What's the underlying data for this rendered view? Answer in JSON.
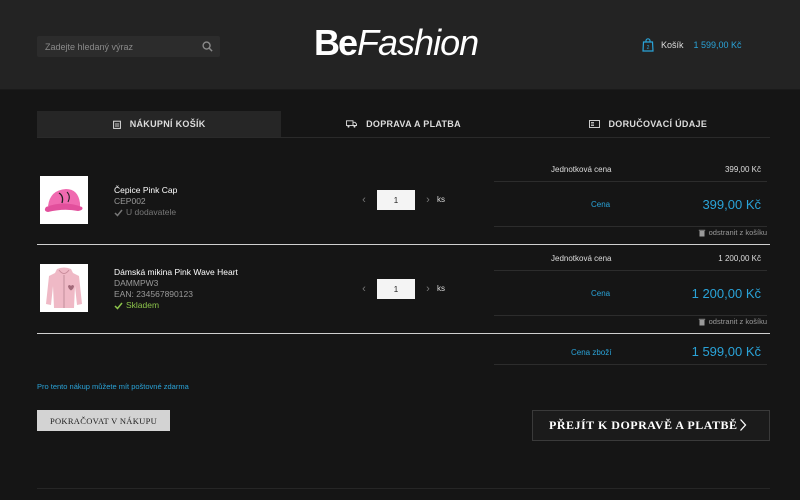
{
  "header": {
    "search_placeholder": "Zadejte hledaný výraz",
    "logo_be": "Be",
    "logo_fashion": "Fashion",
    "cart_label": "Košík",
    "cart_total": "1 599,00 Kč"
  },
  "steps": [
    {
      "label": "NÁKUPNÍ KOŠÍK",
      "icon": "cart-list-icon",
      "active": true
    },
    {
      "label": "DOPRAVA A PLATBA",
      "icon": "truck-icon",
      "active": false
    },
    {
      "label": "DORUČOVACÍ ÚDAJE",
      "icon": "address-card-icon",
      "active": false
    }
  ],
  "items": [
    {
      "name": "Čepice Pink Cap",
      "code": "CEP002",
      "ean": "",
      "availability": "U dodavatele",
      "qty": "1",
      "qty_unit": "ks",
      "unit_price_label": "Jednotková cena",
      "unit_price": "399,00 Kč",
      "total_label": "Cena",
      "total": "399,00 Kč",
      "remove_label": "odstranit z košíku"
    },
    {
      "name": "Dámská mikina Pink Wave Heart",
      "code": "DAMMPW3",
      "ean": "EAN: 234567890123",
      "availability": "Skladem",
      "qty": "1",
      "qty_unit": "ks",
      "unit_price_label": "Jednotková cena",
      "unit_price": "1 200,00 Kč",
      "total_label": "Cena",
      "total": "1 200,00 Kč",
      "remove_label": "odstranit z košíku"
    }
  ],
  "summary": {
    "label": "Cena zboží",
    "value": "1 599,00 Kč"
  },
  "free_shipping_note": "Pro tento nákup můžete mít poštovné zdarma",
  "buttons": {
    "continue": "POKRAČOVAT V NÁKUPU",
    "next": "PŘEJÍT K DOPRAVĚ A PLATBĚ"
  },
  "colors": {
    "accent": "#2aa3d8",
    "in_stock": "#8bc34a",
    "background": "#151515",
    "header": "#232323"
  }
}
